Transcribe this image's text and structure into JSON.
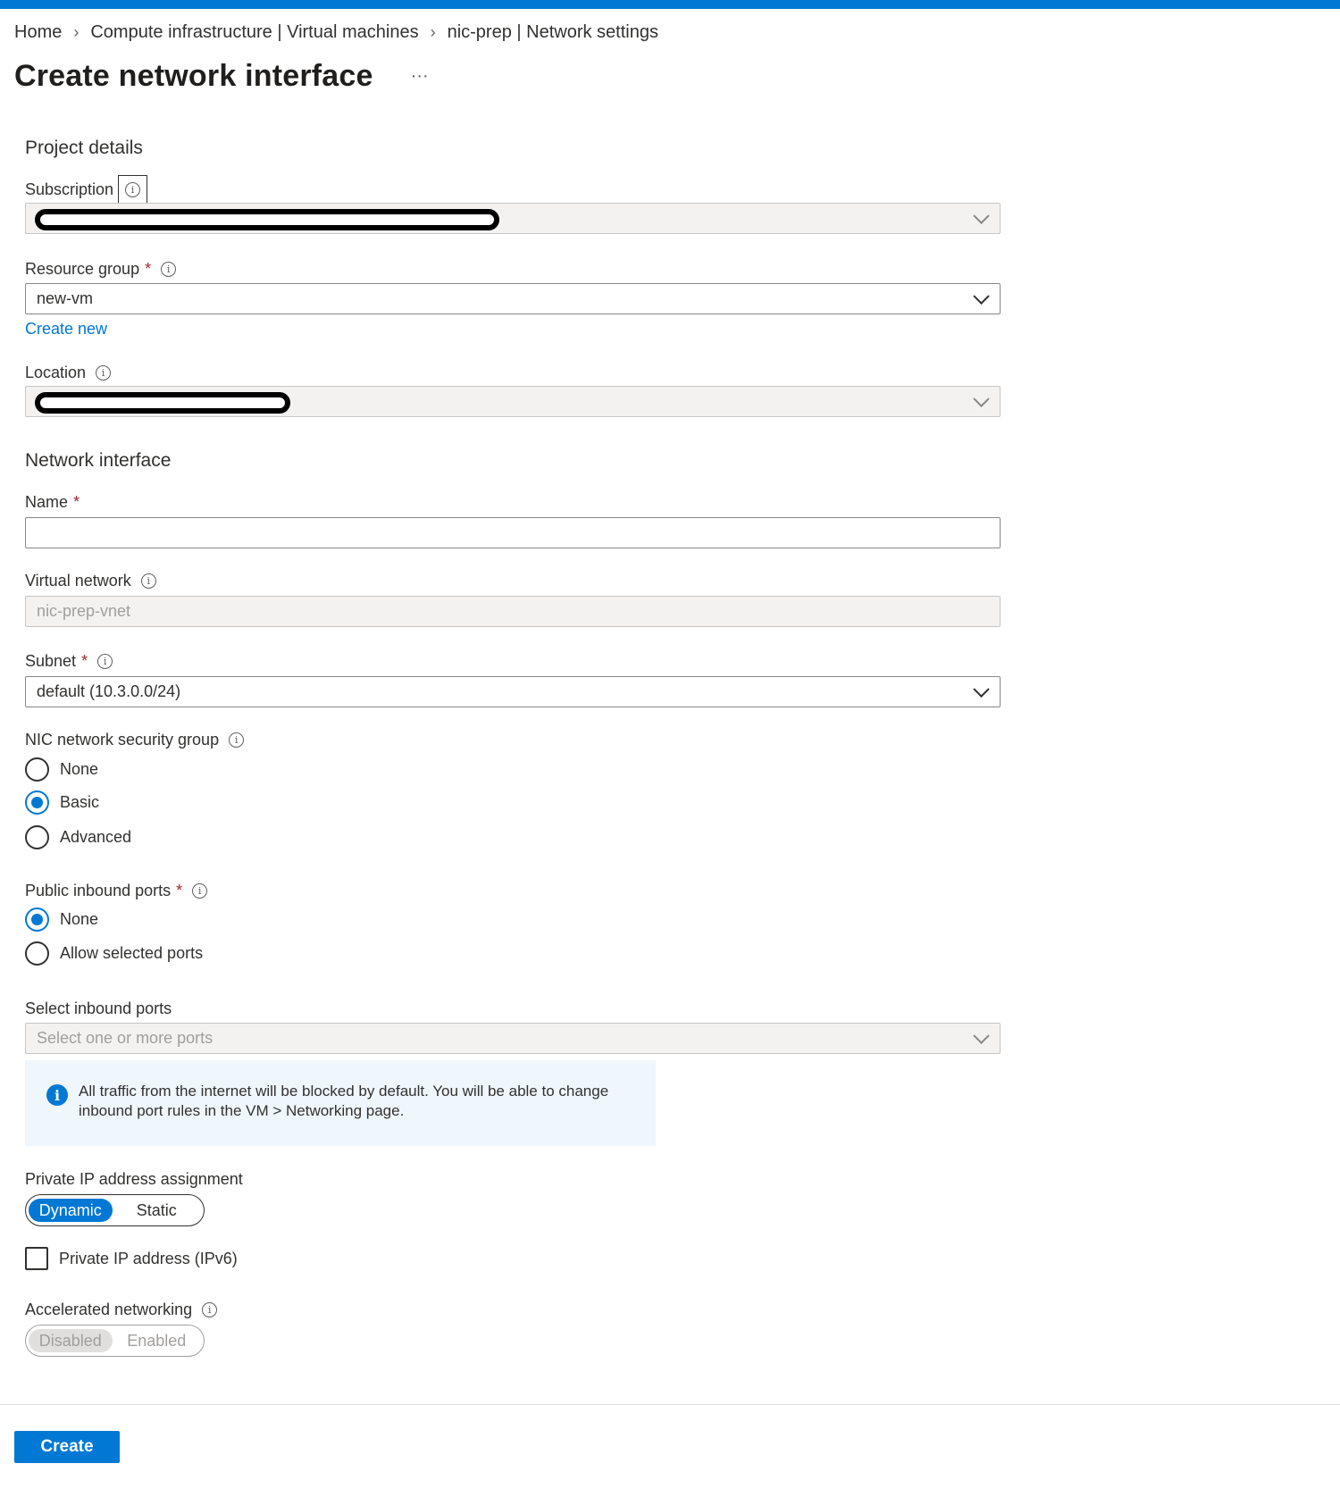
{
  "breadcrumb": [
    "Home",
    "Compute infrastructure | Virtual machines",
    "nic-prep | Network settings"
  ],
  "page": {
    "title": "Create network interface",
    "more": "···"
  },
  "project_details": {
    "title": "Project details",
    "subscription": {
      "label": "Subscription",
      "value": ""
    },
    "resource_group": {
      "label": "Resource group",
      "value": "new-vm",
      "create_new": "Create new"
    },
    "location": {
      "label": "Location",
      "value": ""
    }
  },
  "network_interface": {
    "title": "Network interface",
    "name": {
      "label": "Name",
      "value": ""
    },
    "virtual_network": {
      "label": "Virtual network",
      "value": "nic-prep-vnet"
    },
    "subnet": {
      "label": "Subnet",
      "value": "default (10.3.0.0/24)"
    },
    "nsg": {
      "label": "NIC network security group",
      "options": [
        "None",
        "Basic",
        "Advanced"
      ],
      "selected": "Basic"
    },
    "public_inbound_ports": {
      "label": "Public inbound ports",
      "options": [
        "None",
        "Allow selected ports"
      ],
      "selected": "None"
    },
    "select_inbound_ports": {
      "label": "Select inbound ports",
      "placeholder": "Select one or more ports"
    },
    "info_message": "All traffic from the internet will be blocked by default. You will be able to change inbound port rules in the VM > Networking page.",
    "private_ip_assignment": {
      "label": "Private IP address assignment",
      "options": [
        "Dynamic",
        "Static"
      ],
      "selected": "Dynamic"
    },
    "ipv6": {
      "label": "Private IP address (IPv6)",
      "checked": false
    },
    "accelerated_networking": {
      "label": "Accelerated networking",
      "options": [
        "Disabled",
        "Enabled"
      ],
      "selected": "Disabled",
      "disabled": true
    }
  },
  "footer": {
    "create_label": "Create"
  },
  "colors": {
    "accent": "#0078d4",
    "required": "#a4262c",
    "info_bg": "#eff6fc",
    "disabled_bg": "#f3f2f1"
  }
}
